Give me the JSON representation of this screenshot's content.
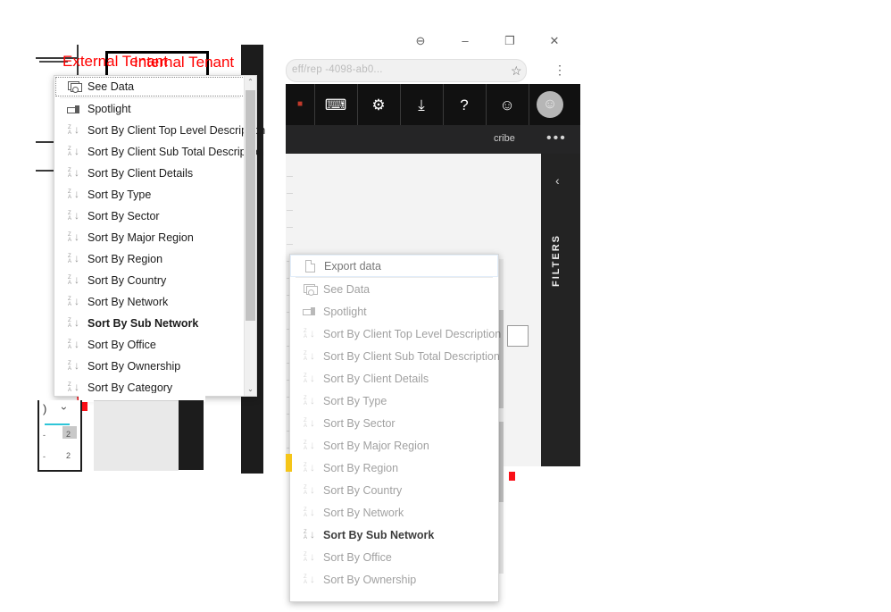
{
  "annotations": {
    "external_tenant_label": "External Tenant",
    "internal_tenant_label": "Internal Tenant",
    "label_color": "#ff0000"
  },
  "left_window": {
    "name": "External Tenant Power BI report",
    "context_menu": {
      "name": "visual-options-menu",
      "focused_item": "See Data",
      "items": [
        {
          "label": "See Data",
          "icon": "see-data-icon",
          "bold": false,
          "focused": true
        },
        {
          "label": "Spotlight",
          "icon": "spotlight-icon",
          "bold": false,
          "focused": false
        },
        {
          "label": "Sort By Client Top Level Description",
          "icon": "sort-za-icon",
          "bold": false,
          "focused": false
        },
        {
          "label": "Sort By Client Sub Total Description",
          "icon": "sort-za-icon",
          "bold": false,
          "focused": false
        },
        {
          "label": "Sort By Client Details",
          "icon": "sort-za-icon",
          "bold": false,
          "focused": false
        },
        {
          "label": "Sort By Type",
          "icon": "sort-za-icon",
          "bold": false,
          "focused": false
        },
        {
          "label": "Sort By Sector",
          "icon": "sort-za-icon",
          "bold": false,
          "focused": false
        },
        {
          "label": "Sort By Major Region",
          "icon": "sort-za-icon",
          "bold": false,
          "focused": false
        },
        {
          "label": "Sort By Region",
          "icon": "sort-za-icon",
          "bold": false,
          "focused": false
        },
        {
          "label": "Sort By Country",
          "icon": "sort-za-icon",
          "bold": false,
          "focused": false
        },
        {
          "label": "Sort By Network",
          "icon": "sort-za-icon",
          "bold": false,
          "focused": false
        },
        {
          "label": "Sort By Sub Network",
          "icon": "sort-za-icon",
          "bold": true,
          "focused": false
        },
        {
          "label": "Sort By Office",
          "icon": "sort-za-icon",
          "bold": false,
          "focused": false
        },
        {
          "label": "Sort By Ownership",
          "icon": "sort-za-icon",
          "bold": false,
          "focused": false
        },
        {
          "label": "Sort By Category",
          "icon": "sort-za-icon",
          "bold": false,
          "focused": false
        }
      ],
      "scrollbar": {
        "up_arrow": "⌃",
        "down_arrow": "⌄"
      }
    }
  },
  "right_window": {
    "name": "Internal Tenant browser window",
    "titlebar": {
      "buttons": [
        {
          "name": "print-icon",
          "glyph": "⊖"
        },
        {
          "name": "minimize-button",
          "glyph": "–"
        },
        {
          "name": "restore-button",
          "glyph": "❐"
        },
        {
          "name": "close-button",
          "glyph": "✕"
        }
      ]
    },
    "address_bar": {
      "url_text": "eff/rep                      -4098-ab0...",
      "bookmark_icon": "☆",
      "menu_icon": "⋮"
    },
    "app_toolbar": {
      "items": [
        {
          "name": "comment-icon",
          "glyph": "⌨"
        },
        {
          "name": "settings-gear-icon",
          "glyph": "⚙"
        },
        {
          "name": "download-icon",
          "glyph": "⤓"
        },
        {
          "name": "help-icon",
          "glyph": "?"
        },
        {
          "name": "feedback-smiley-icon",
          "glyph": "☺"
        },
        {
          "name": "user-avatar",
          "glyph": "☺"
        }
      ]
    },
    "report_header": {
      "subscribe_label": "cribe",
      "more_options": "•••"
    },
    "filters_pane": {
      "title": "FILTERS",
      "collapse_icon": "‹"
    },
    "context_menu": {
      "name": "visual-options-menu",
      "selected_item": "Export data",
      "items": [
        {
          "label": "Export data",
          "icon": "export-data-icon",
          "bold": false,
          "selected": true
        },
        {
          "label": "See Data",
          "icon": "see-data-icon",
          "bold": false,
          "selected": false
        },
        {
          "label": "Spotlight",
          "icon": "spotlight-icon",
          "bold": false,
          "selected": false
        },
        {
          "label": "Sort By Client Top Level Description",
          "icon": "sort-za-icon",
          "bold": false,
          "selected": false
        },
        {
          "label": "Sort By Client Sub Total Description",
          "icon": "sort-za-icon",
          "bold": false,
          "selected": false
        },
        {
          "label": "Sort By Client Details",
          "icon": "sort-za-icon",
          "bold": false,
          "selected": false
        },
        {
          "label": "Sort By Type",
          "icon": "sort-za-icon",
          "bold": false,
          "selected": false
        },
        {
          "label": "Sort By Sector",
          "icon": "sort-za-icon",
          "bold": false,
          "selected": false
        },
        {
          "label": "Sort By Major Region",
          "icon": "sort-za-icon",
          "bold": false,
          "selected": false
        },
        {
          "label": "Sort By Region",
          "icon": "sort-za-icon",
          "bold": false,
          "selected": false
        },
        {
          "label": "Sort By Country",
          "icon": "sort-za-icon",
          "bold": false,
          "selected": false
        },
        {
          "label": "Sort By Network",
          "icon": "sort-za-icon",
          "bold": false,
          "selected": false
        },
        {
          "label": "Sort By Sub Network",
          "icon": "sort-za-icon",
          "bold": true,
          "selected": false
        },
        {
          "label": "Sort By Office",
          "icon": "sort-za-icon",
          "bold": false,
          "selected": false
        },
        {
          "label": "Sort By Ownership",
          "icon": "sort-za-icon",
          "bold": false,
          "selected": false
        }
      ]
    }
  },
  "colors": {
    "bar_yellow": "#f5c518",
    "bar_red": "#fa0f17",
    "toolbar_dark": "#111111",
    "filters_dark": "#232323",
    "accent_cyan": "#2ec5d8"
  }
}
